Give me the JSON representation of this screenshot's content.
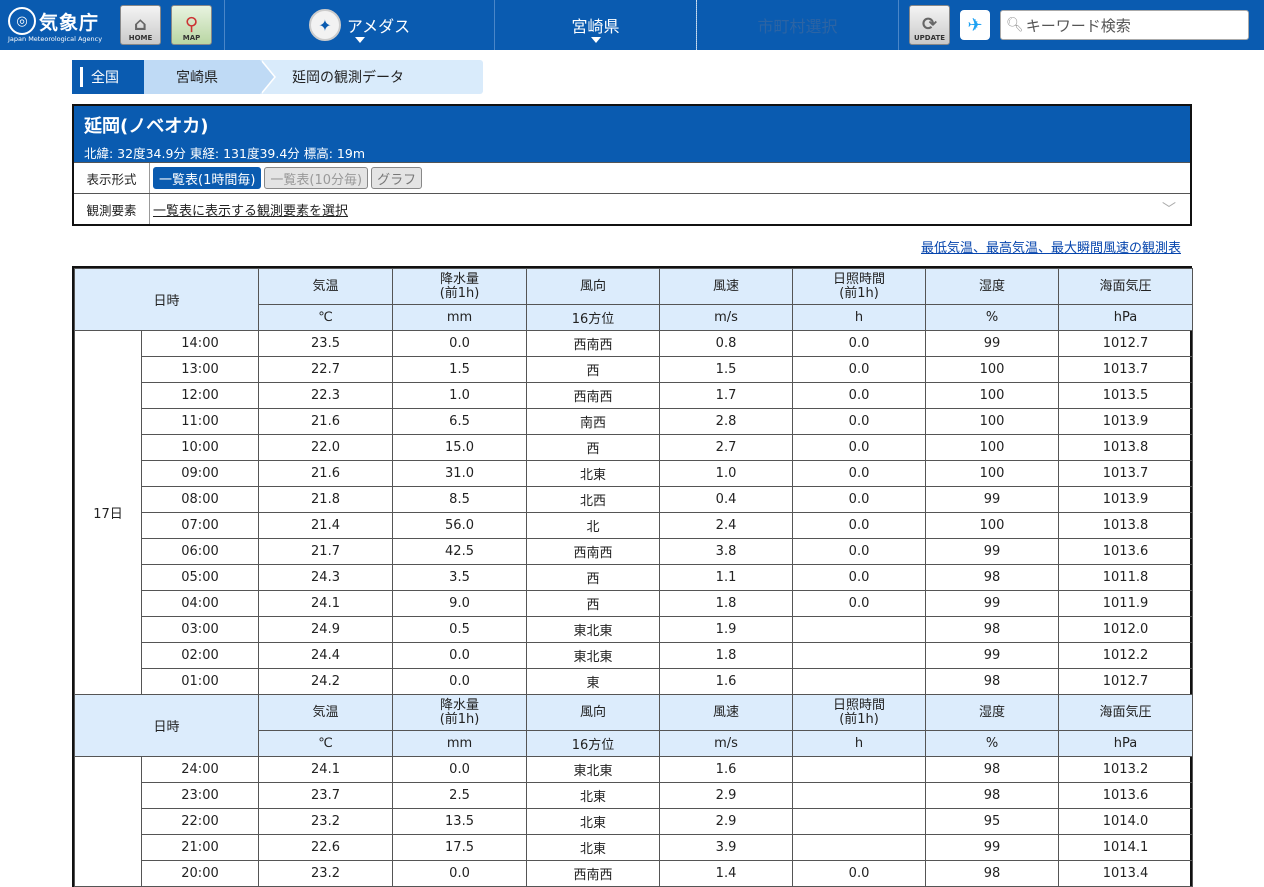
{
  "header": {
    "logo_jp": "気象庁",
    "logo_en": "Japan Meteorological Agency",
    "home_label": "HOME",
    "map_label": "MAP",
    "nav_amedas": "アメダス",
    "nav_pref": "宮崎県",
    "nav_city": "市町村選択",
    "update_label": "UPDATE",
    "search_placeholder": "キーワード検索"
  },
  "breadcrumb": [
    "全国",
    "宮崎県",
    "延岡の観測データ"
  ],
  "station": {
    "name": "延岡(ノベオカ)",
    "coords": "北緯: 32度34.9分 東経: 131度39.4分 標高: 19m",
    "format_label": "表示形式",
    "format_buttons": [
      "一覧表(1時間毎)",
      "一覧表(10分毎)",
      "グラフ"
    ],
    "element_label": "観測要素",
    "element_select": "一覧表に表示する観測要素を選択"
  },
  "extremes_link": "最低気温、最高気温、最大瞬間風速の観測表",
  "table": {
    "head_datetime": "日時",
    "columns": [
      "気温",
      "降水量\n(前1h)",
      "風向",
      "風速",
      "日照時間\n(前1h)",
      "湿度",
      "海面気圧"
    ],
    "units": [
      "℃",
      "mm",
      "16方位",
      "m/s",
      "h",
      "%",
      "hPa"
    ],
    "day1": "17日",
    "rows1": [
      [
        "14:00",
        "23.5",
        "0.0",
        "西南西",
        "0.8",
        "0.0",
        "99",
        "1012.7"
      ],
      [
        "13:00",
        "22.7",
        "1.5",
        "西",
        "1.5",
        "0.0",
        "100",
        "1013.7"
      ],
      [
        "12:00",
        "22.3",
        "1.0",
        "西南西",
        "1.7",
        "0.0",
        "100",
        "1013.5"
      ],
      [
        "11:00",
        "21.6",
        "6.5",
        "南西",
        "2.8",
        "0.0",
        "100",
        "1013.9"
      ],
      [
        "10:00",
        "22.0",
        "15.0",
        "西",
        "2.7",
        "0.0",
        "100",
        "1013.8"
      ],
      [
        "09:00",
        "21.6",
        "31.0",
        "北東",
        "1.0",
        "0.0",
        "100",
        "1013.7"
      ],
      [
        "08:00",
        "21.8",
        "8.5",
        "北西",
        "0.4",
        "0.0",
        "99",
        "1013.9"
      ],
      [
        "07:00",
        "21.4",
        "56.0",
        "北",
        "2.4",
        "0.0",
        "100",
        "1013.8"
      ],
      [
        "06:00",
        "21.7",
        "42.5",
        "西南西",
        "3.8",
        "0.0",
        "99",
        "1013.6"
      ],
      [
        "05:00",
        "24.3",
        "3.5",
        "西",
        "1.1",
        "0.0",
        "98",
        "1011.8"
      ],
      [
        "04:00",
        "24.1",
        "9.0",
        "西",
        "1.8",
        "0.0",
        "99",
        "1011.9"
      ],
      [
        "03:00",
        "24.9",
        "0.5",
        "東北東",
        "1.9",
        "",
        "98",
        "1012.0"
      ],
      [
        "02:00",
        "24.4",
        "0.0",
        "東北東",
        "1.8",
        "",
        "99",
        "1012.2"
      ],
      [
        "01:00",
        "24.2",
        "0.0",
        "東",
        "1.6",
        "",
        "98",
        "1012.7"
      ]
    ],
    "rows2": [
      [
        "24:00",
        "24.1",
        "0.0",
        "東北東",
        "1.6",
        "",
        "98",
        "1013.2"
      ],
      [
        "23:00",
        "23.7",
        "2.5",
        "北東",
        "2.9",
        "",
        "98",
        "1013.6"
      ],
      [
        "22:00",
        "23.2",
        "13.5",
        "北東",
        "2.9",
        "",
        "95",
        "1014.0"
      ],
      [
        "21:00",
        "22.6",
        "17.5",
        "北東",
        "3.9",
        "",
        "99",
        "1014.1"
      ],
      [
        "20:00",
        "23.2",
        "0.0",
        "西南西",
        "1.4",
        "0.0",
        "98",
        "1013.4"
      ]
    ]
  }
}
